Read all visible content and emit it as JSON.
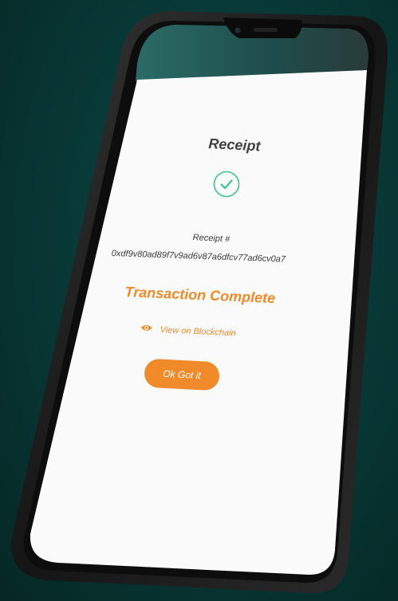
{
  "screen": {
    "title": "Receipt",
    "receipt_label": "Receipt #",
    "receipt_hash": "0xdf9v80ad89f7v9ad6v87a6dfcv77ad6cv0a7",
    "status": "Transaction Complete",
    "view_link_label": "View on Blockchain",
    "ok_button_label": "Ok Got it"
  },
  "icons": {
    "status": "check-circle-icon",
    "view_link": "eye-icon"
  },
  "colors": {
    "background": "#083a37",
    "accent": "#f08a2a",
    "success": "#3cc58a",
    "screen": "#fafafa",
    "phone_body": "#1b1b1b"
  }
}
